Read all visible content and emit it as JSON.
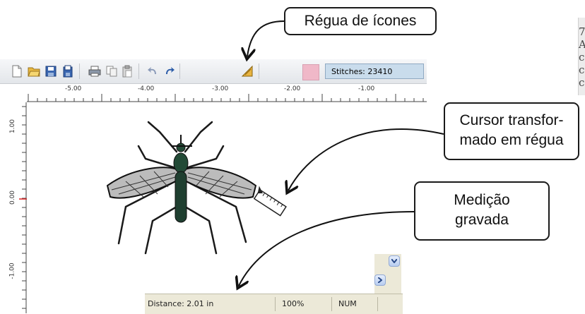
{
  "callouts": {
    "toolbar": "Régua de ícones",
    "cursor_line1": "Cursor transfor-",
    "cursor_line2": "mado em régua",
    "measure_line1": "Medição",
    "measure_line2": "gravada"
  },
  "toolbar": {
    "stitches_label": "Stitches: 23410",
    "swatch_color": "#f0b8c8"
  },
  "ruler_top_labels": [
    "-5.00",
    "-4.00",
    "-3.00",
    "-2.00",
    "-1.00"
  ],
  "ruler_left_labels": [
    "1.00",
    "0.00",
    "-1.00"
  ],
  "status_bar": {
    "distance": "Distance: 2.01 in",
    "zoom": "100%",
    "num": "NUM"
  },
  "side_fragments": [
    "7",
    "A",
    "c",
    "c",
    "c"
  ],
  "icons": [
    "new-file-icon",
    "open-folder-icon",
    "save-icon",
    "save-as-icon",
    "print-icon",
    "copy-icon",
    "paste-icon",
    "undo-icon",
    "redo-icon",
    "measure-ruler-icon",
    "color-swatch-icon",
    "chevron-down-icon",
    "chevron-right-icon",
    "ruler-cursor-icon",
    "mosquito-design"
  ]
}
